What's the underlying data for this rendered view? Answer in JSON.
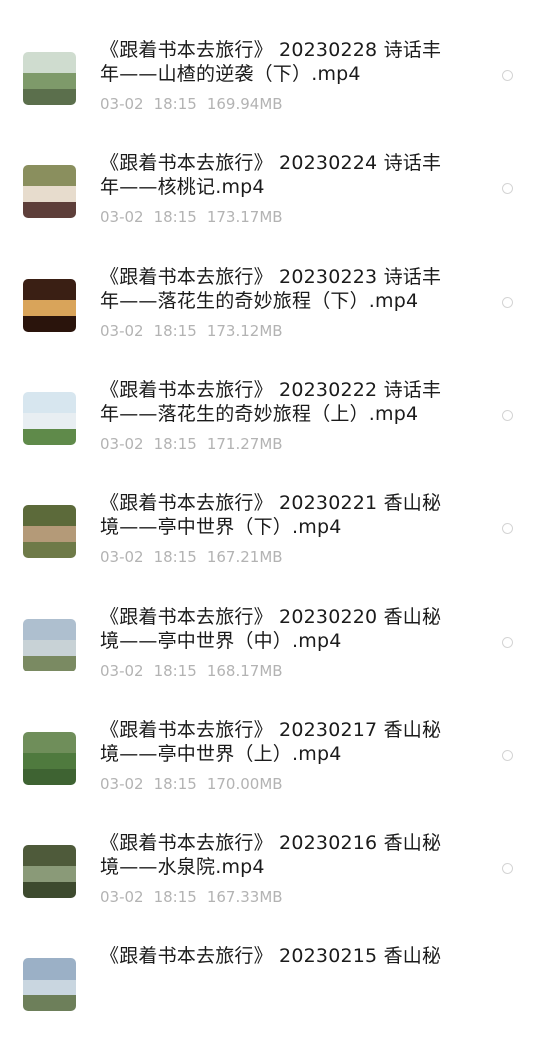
{
  "files": [
    {
      "title": "《跟着书本去旅行》 20230228 诗话丰年——山楂的逆袭（下）.mp4",
      "date": "03-02",
      "time": "18:15",
      "size": "169.94MB",
      "thumb_colors": [
        "#cfdccf",
        "#7e9a6a",
        "#5b6f4c"
      ]
    },
    {
      "title": "《跟着书本去旅行》 20230224 诗话丰年——核桃记.mp4",
      "date": "03-02",
      "time": "18:15",
      "size": "173.17MB",
      "thumb_colors": [
        "#8a8f5e",
        "#e7dccd",
        "#5e3f3a"
      ]
    },
    {
      "title": "《跟着书本去旅行》 20230223 诗话丰年——落花生的奇妙旅程（下）.mp4",
      "date": "03-02",
      "time": "18:15",
      "size": "173.12MB",
      "thumb_colors": [
        "#3a1f14",
        "#d9a45a",
        "#2a140c"
      ]
    },
    {
      "title": "《跟着书本去旅行》 20230222 诗话丰年——落花生的奇妙旅程（上）.mp4",
      "date": "03-02",
      "time": "18:15",
      "size": "171.27MB",
      "thumb_colors": [
        "#d7e6ef",
        "#e8eef2",
        "#5f8a4a"
      ]
    },
    {
      "title": "《跟着书本去旅行》 20230221 香山秘境——亭中世界（下）.mp4",
      "date": "03-02",
      "time": "18:15",
      "size": "167.21MB",
      "thumb_colors": [
        "#5c6a3a",
        "#b49a78",
        "#6e7a48"
      ]
    },
    {
      "title": "《跟着书本去旅行》 20230220 香山秘境——亭中世界（中）.mp4",
      "date": "03-02",
      "time": "18:15",
      "size": "168.17MB",
      "thumb_colors": [
        "#aebfcf",
        "#c8d2d6",
        "#7a8a62"
      ]
    },
    {
      "title": "《跟着书本去旅行》 20230217 香山秘境——亭中世界（上）.mp4",
      "date": "03-02",
      "time": "18:15",
      "size": "170.00MB",
      "thumb_colors": [
        "#6f8e5a",
        "#4f7a3e",
        "#3e6332"
      ]
    },
    {
      "title": "《跟着书本去旅行》 20230216 香山秘境——水泉院.mp4",
      "date": "03-02",
      "time": "18:15",
      "size": "167.33MB",
      "thumb_colors": [
        "#4e5a3a",
        "#8a9a78",
        "#3d4a2e"
      ]
    },
    {
      "title": "《跟着书本去旅行》 20230215 香山秘",
      "date": "",
      "time": "",
      "size": "",
      "thumb_colors": [
        "#9bb0c6",
        "#c9d6e0",
        "#6d7f5a"
      ]
    }
  ]
}
